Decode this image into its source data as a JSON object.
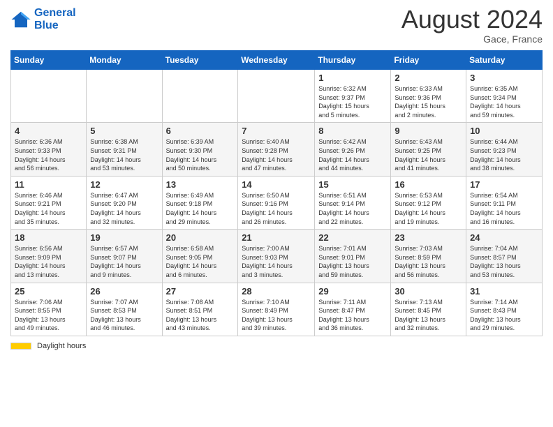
{
  "header": {
    "logo_line1": "General",
    "logo_line2": "Blue",
    "month_year": "August 2024",
    "location": "Gace, France"
  },
  "footer": {
    "daylight_label": "Daylight hours"
  },
  "weekdays": [
    "Sunday",
    "Monday",
    "Tuesday",
    "Wednesday",
    "Thursday",
    "Friday",
    "Saturday"
  ],
  "weeks": [
    [
      {
        "day": "",
        "info": ""
      },
      {
        "day": "",
        "info": ""
      },
      {
        "day": "",
        "info": ""
      },
      {
        "day": "",
        "info": ""
      },
      {
        "day": "1",
        "info": "Sunrise: 6:32 AM\nSunset: 9:37 PM\nDaylight: 15 hours\nand 5 minutes."
      },
      {
        "day": "2",
        "info": "Sunrise: 6:33 AM\nSunset: 9:36 PM\nDaylight: 15 hours\nand 2 minutes."
      },
      {
        "day": "3",
        "info": "Sunrise: 6:35 AM\nSunset: 9:34 PM\nDaylight: 14 hours\nand 59 minutes."
      }
    ],
    [
      {
        "day": "4",
        "info": "Sunrise: 6:36 AM\nSunset: 9:33 PM\nDaylight: 14 hours\nand 56 minutes."
      },
      {
        "day": "5",
        "info": "Sunrise: 6:38 AM\nSunset: 9:31 PM\nDaylight: 14 hours\nand 53 minutes."
      },
      {
        "day": "6",
        "info": "Sunrise: 6:39 AM\nSunset: 9:30 PM\nDaylight: 14 hours\nand 50 minutes."
      },
      {
        "day": "7",
        "info": "Sunrise: 6:40 AM\nSunset: 9:28 PM\nDaylight: 14 hours\nand 47 minutes."
      },
      {
        "day": "8",
        "info": "Sunrise: 6:42 AM\nSunset: 9:26 PM\nDaylight: 14 hours\nand 44 minutes."
      },
      {
        "day": "9",
        "info": "Sunrise: 6:43 AM\nSunset: 9:25 PM\nDaylight: 14 hours\nand 41 minutes."
      },
      {
        "day": "10",
        "info": "Sunrise: 6:44 AM\nSunset: 9:23 PM\nDaylight: 14 hours\nand 38 minutes."
      }
    ],
    [
      {
        "day": "11",
        "info": "Sunrise: 6:46 AM\nSunset: 9:21 PM\nDaylight: 14 hours\nand 35 minutes."
      },
      {
        "day": "12",
        "info": "Sunrise: 6:47 AM\nSunset: 9:20 PM\nDaylight: 14 hours\nand 32 minutes."
      },
      {
        "day": "13",
        "info": "Sunrise: 6:49 AM\nSunset: 9:18 PM\nDaylight: 14 hours\nand 29 minutes."
      },
      {
        "day": "14",
        "info": "Sunrise: 6:50 AM\nSunset: 9:16 PM\nDaylight: 14 hours\nand 26 minutes."
      },
      {
        "day": "15",
        "info": "Sunrise: 6:51 AM\nSunset: 9:14 PM\nDaylight: 14 hours\nand 22 minutes."
      },
      {
        "day": "16",
        "info": "Sunrise: 6:53 AM\nSunset: 9:12 PM\nDaylight: 14 hours\nand 19 minutes."
      },
      {
        "day": "17",
        "info": "Sunrise: 6:54 AM\nSunset: 9:11 PM\nDaylight: 14 hours\nand 16 minutes."
      }
    ],
    [
      {
        "day": "18",
        "info": "Sunrise: 6:56 AM\nSunset: 9:09 PM\nDaylight: 14 hours\nand 13 minutes."
      },
      {
        "day": "19",
        "info": "Sunrise: 6:57 AM\nSunset: 9:07 PM\nDaylight: 14 hours\nand 9 minutes."
      },
      {
        "day": "20",
        "info": "Sunrise: 6:58 AM\nSunset: 9:05 PM\nDaylight: 14 hours\nand 6 minutes."
      },
      {
        "day": "21",
        "info": "Sunrise: 7:00 AM\nSunset: 9:03 PM\nDaylight: 14 hours\nand 3 minutes."
      },
      {
        "day": "22",
        "info": "Sunrise: 7:01 AM\nSunset: 9:01 PM\nDaylight: 13 hours\nand 59 minutes."
      },
      {
        "day": "23",
        "info": "Sunrise: 7:03 AM\nSunset: 8:59 PM\nDaylight: 13 hours\nand 56 minutes."
      },
      {
        "day": "24",
        "info": "Sunrise: 7:04 AM\nSunset: 8:57 PM\nDaylight: 13 hours\nand 53 minutes."
      }
    ],
    [
      {
        "day": "25",
        "info": "Sunrise: 7:06 AM\nSunset: 8:55 PM\nDaylight: 13 hours\nand 49 minutes."
      },
      {
        "day": "26",
        "info": "Sunrise: 7:07 AM\nSunset: 8:53 PM\nDaylight: 13 hours\nand 46 minutes."
      },
      {
        "day": "27",
        "info": "Sunrise: 7:08 AM\nSunset: 8:51 PM\nDaylight: 13 hours\nand 43 minutes."
      },
      {
        "day": "28",
        "info": "Sunrise: 7:10 AM\nSunset: 8:49 PM\nDaylight: 13 hours\nand 39 minutes."
      },
      {
        "day": "29",
        "info": "Sunrise: 7:11 AM\nSunset: 8:47 PM\nDaylight: 13 hours\nand 36 minutes."
      },
      {
        "day": "30",
        "info": "Sunrise: 7:13 AM\nSunset: 8:45 PM\nDaylight: 13 hours\nand 32 minutes."
      },
      {
        "day": "31",
        "info": "Sunrise: 7:14 AM\nSunset: 8:43 PM\nDaylight: 13 hours\nand 29 minutes."
      }
    ]
  ]
}
